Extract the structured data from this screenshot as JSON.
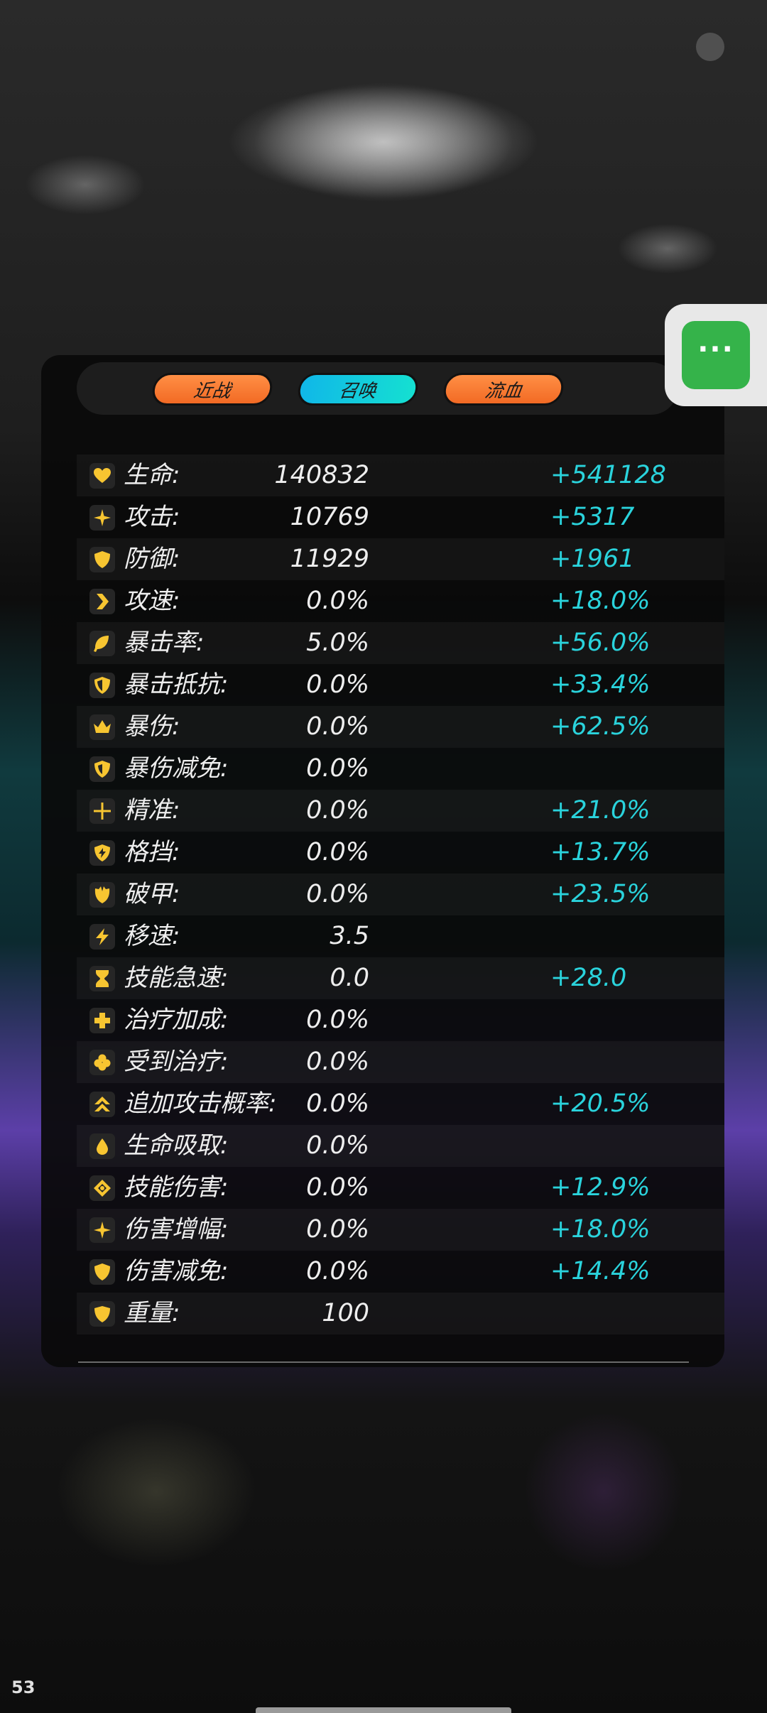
{
  "tabs": [
    {
      "label": "近战",
      "color": "#f26a24"
    },
    {
      "label": "召唤",
      "color": "#15c7df"
    },
    {
      "label": "流血",
      "color": "#f26a24"
    }
  ],
  "stats": [
    {
      "label": "生命:",
      "value": "140832",
      "bonus": "+541128",
      "icon": "heart-icon"
    },
    {
      "label": "攻击:",
      "value": "10769",
      "bonus": "+5317",
      "icon": "star-icon"
    },
    {
      "label": "防御:",
      "value": "11929",
      "bonus": "+1961",
      "icon": "shield-icon"
    },
    {
      "label": "攻速:",
      "value": "0.0%",
      "bonus": "+18.0%",
      "icon": "chevron-right-icon"
    },
    {
      "label": "暴击率:",
      "value": "5.0%",
      "bonus": "+56.0%",
      "icon": "leaf-icon"
    },
    {
      "label": "暴击抵抗:",
      "value": "0.0%",
      "bonus": "+33.4%",
      "icon": "half-shield-icon"
    },
    {
      "label": "暴伤:",
      "value": "0.0%",
      "bonus": "+62.5%",
      "icon": "crown-icon"
    },
    {
      "label": "暴伤减免:",
      "value": "0.0%",
      "bonus": "",
      "icon": "crown-shield-icon"
    },
    {
      "label": "精准:",
      "value": "0.0%",
      "bonus": "+21.0%",
      "icon": "crosshair-icon"
    },
    {
      "label": "格挡:",
      "value": "0.0%",
      "bonus": "+13.7%",
      "icon": "bolt-shield-icon"
    },
    {
      "label": "破甲:",
      "value": "0.0%",
      "bonus": "+23.5%",
      "icon": "broken-shield-icon"
    },
    {
      "label": "移速:",
      "value": "3.5",
      "bonus": "",
      "icon": "lightning-icon"
    },
    {
      "label": "技能急速:",
      "value": "0.0",
      "bonus": "+28.0",
      "icon": "hourglass-icon"
    },
    {
      "label": "治疗加成:",
      "value": "0.0%",
      "bonus": "",
      "icon": "plus-icon"
    },
    {
      "label": "受到治疗:",
      "value": "0.0%",
      "bonus": "",
      "icon": "clover-icon"
    },
    {
      "label": "追加攻击概率:",
      "value": "0.0%",
      "bonus": "+20.5%",
      "icon": "double-up-icon"
    },
    {
      "label": "生命吸取:",
      "value": "0.0%",
      "bonus": "",
      "icon": "drop-icon"
    },
    {
      "label": "技能伤害:",
      "value": "0.0%",
      "bonus": "+12.9%",
      "icon": "target-icon"
    },
    {
      "label": "伤害增幅:",
      "value": "0.0%",
      "bonus": "+18.0%",
      "icon": "sparkle-icon"
    },
    {
      "label": "伤害减免:",
      "value": "0.0%",
      "bonus": "+14.4%",
      "icon": "shield-icon"
    },
    {
      "label": "重量:",
      "value": "100",
      "bonus": "",
      "icon": "weight-shield-icon"
    }
  ],
  "menu_button": {
    "label": "···",
    "icon": "more-icon",
    "color": "#35b34a"
  },
  "fps": "53",
  "colors": {
    "bonus": "#2ad3dc",
    "icon": "#f7c531"
  }
}
